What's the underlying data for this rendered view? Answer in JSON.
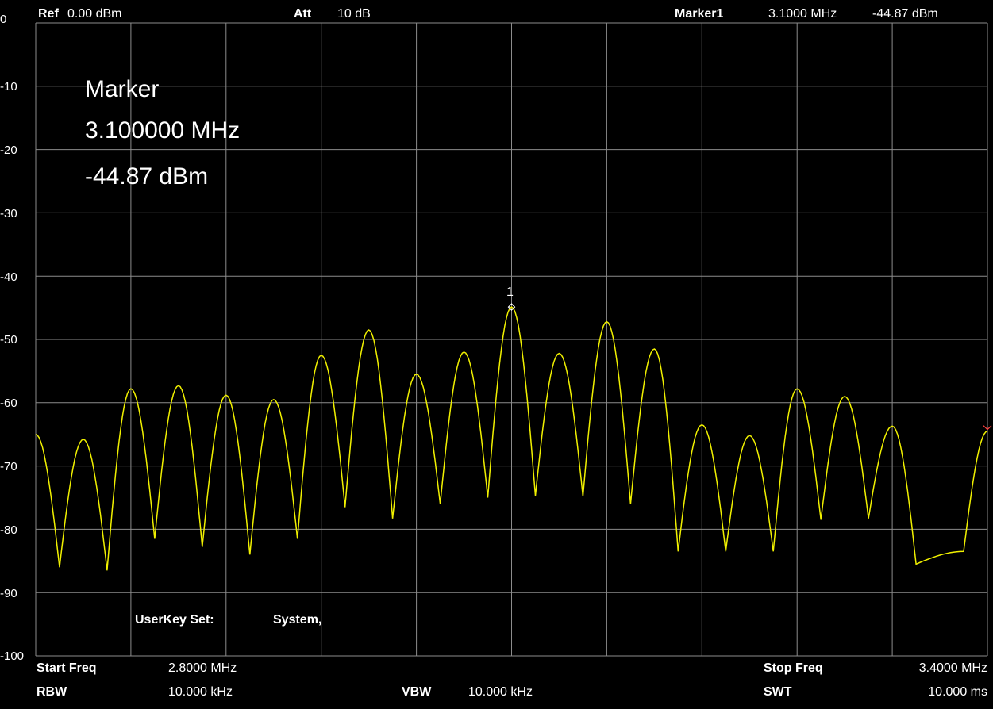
{
  "header": {
    "ref_label": "Ref",
    "ref_value": "0.00 dBm",
    "att_label": "Att",
    "att_value": "10 dB",
    "marker_label": "Marker1",
    "marker_freq": "3.1000 MHz",
    "marker_level": "-44.87 dBm"
  },
  "marker_box": {
    "title": "Marker",
    "freq": "3.100000 MHz",
    "level": "-44.87 dBm",
    "tag": "1"
  },
  "userkey": {
    "label": "UserKey Set:",
    "value": "System,"
  },
  "footer": {
    "start_label": "Start Freq",
    "start_value": "2.8000 MHz",
    "stop_label": "Stop Freq",
    "stop_value": "3.4000 MHz",
    "rbw_label": "RBW",
    "rbw_value": "10.000 kHz",
    "vbw_label": "VBW",
    "vbw_value": "10.000 kHz",
    "swt_label": "SWT",
    "swt_value": "10.000 ms"
  },
  "colors": {
    "trace": "#f0f000",
    "grid": "#8c8c8c",
    "background": "#000000",
    "marker": "#ffffff",
    "ref_tick": "#ff4040"
  },
  "chart_data": {
    "type": "line",
    "y_tick_labels": [
      "0",
      "-10",
      "-20",
      "-30",
      "-40",
      "-50",
      "-60",
      "-70",
      "-80",
      "-90",
      "-100"
    ],
    "ylim": [
      -100,
      0
    ],
    "xlim": [
      2.8,
      3.4
    ],
    "grid": true,
    "peaks": [
      [
        2.8,
        -65.0
      ],
      [
        2.83,
        -65.8
      ],
      [
        2.86,
        -57.8
      ],
      [
        2.89,
        -57.3
      ],
      [
        2.92,
        -58.8
      ],
      [
        2.95,
        -59.5
      ],
      [
        2.98,
        -52.5
      ],
      [
        3.01,
        -48.5
      ],
      [
        3.04,
        -55.5
      ],
      [
        3.07,
        -52.0
      ],
      [
        3.1,
        -44.87
      ],
      [
        3.13,
        -52.2
      ],
      [
        3.16,
        -47.2
      ],
      [
        3.19,
        -51.5
      ],
      [
        3.22,
        -63.5
      ],
      [
        3.25,
        -65.2
      ],
      [
        3.28,
        -57.8
      ],
      [
        3.31,
        -59.0
      ],
      [
        3.34,
        -63.7
      ],
      [
        3.4,
        -64.5
      ]
    ],
    "nulls": [
      [
        2.815,
        -86.0
      ],
      [
        2.845,
        -86.5
      ],
      [
        2.875,
        -81.5
      ],
      [
        2.905,
        -82.8
      ],
      [
        2.935,
        -84.0
      ],
      [
        2.965,
        -81.5
      ],
      [
        2.995,
        -76.5
      ],
      [
        3.025,
        -78.3
      ],
      [
        3.055,
        -76.0
      ],
      [
        3.085,
        -75.0
      ],
      [
        3.115,
        -74.7
      ],
      [
        3.145,
        -74.8
      ],
      [
        3.175,
        -76.0
      ],
      [
        3.205,
        -83.5
      ],
      [
        3.235,
        -83.5
      ],
      [
        3.265,
        -83.5
      ],
      [
        3.295,
        -78.5
      ],
      [
        3.325,
        -78.3
      ],
      [
        3.355,
        -85.5
      ],
      [
        3.385,
        -83.5
      ]
    ],
    "marker": {
      "x": 3.1,
      "y": -44.87
    }
  }
}
